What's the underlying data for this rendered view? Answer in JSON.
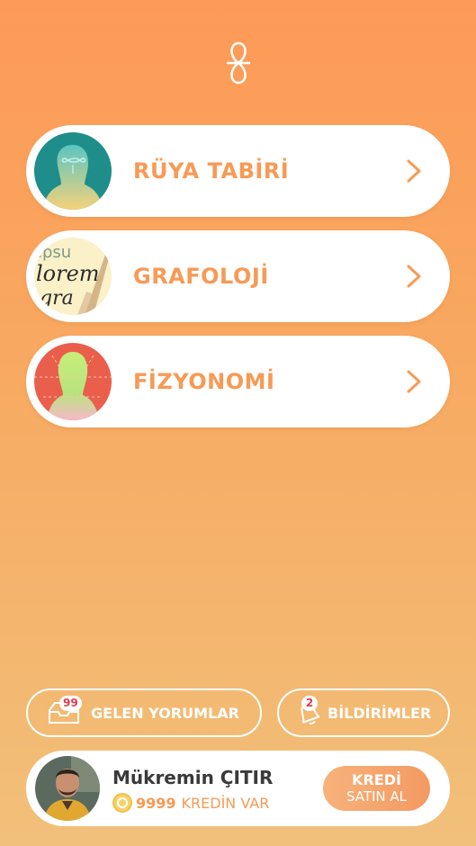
{
  "menu": [
    {
      "label": "RÜYA TABİRİ",
      "icon": "dream-head-icon"
    },
    {
      "label": "GRAFOLOJİ",
      "icon": "handwriting-icon"
    },
    {
      "label": "FİZYONOMİ",
      "icon": "face-silhouette-icon"
    }
  ],
  "bottom": {
    "comments": {
      "label": "GELEN YORUMLAR",
      "count": "99",
      "icon": "inbox-icon"
    },
    "notifications": {
      "label": "BİLDİRİMLER",
      "count": "2",
      "icon": "bell-icon"
    }
  },
  "profile": {
    "name": "Mükremin ÇITIR",
    "credits": "9999",
    "credits_text": "KREDİN VAR",
    "buy_line1": "KREDİ",
    "buy_line2": "SATIN AL"
  },
  "colors": {
    "accent": "#f79a55",
    "badge": "#e23a4a"
  },
  "handwriting_sample": [
    "ipsu",
    "lorem",
    "gra"
  ]
}
